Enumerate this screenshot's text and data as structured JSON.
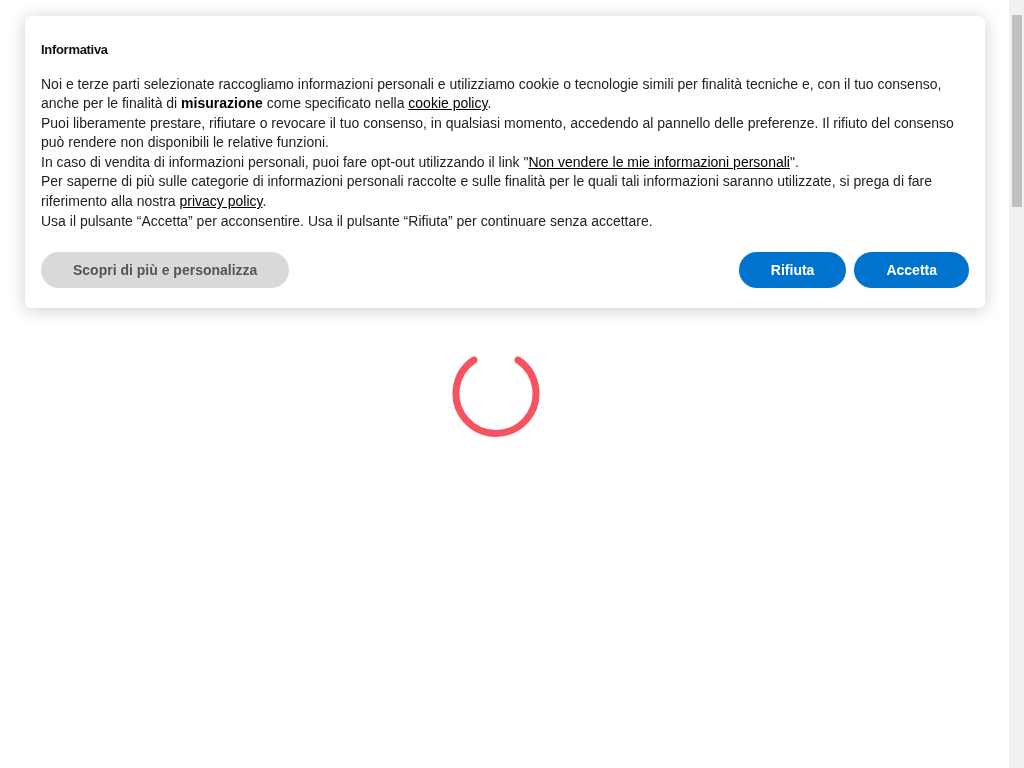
{
  "dialog": {
    "title": "Informativa",
    "paragraphs": [
      [
        {
          "kind": "text",
          "text": "Noi e terze parti selezionate raccogliamo informazioni personali e utilizziamo cookie o tecnologie simili per finalità tecniche e, con il tuo consenso, anche per le finalità di "
        },
        {
          "kind": "bold",
          "text": "misurazione"
        },
        {
          "kind": "text",
          "text": " come specificato nella "
        },
        {
          "kind": "link",
          "text": "cookie policy"
        },
        {
          "kind": "text",
          "text": "."
        }
      ],
      [
        {
          "kind": "text",
          "text": "Puoi liberamente prestare, rifiutare o revocare il tuo consenso, in qualsiasi momento, accedendo al pannello delle preferenze. Il rifiuto del consenso può rendere non disponibili le relative funzioni."
        }
      ],
      [
        {
          "kind": "text",
          "text": "In caso di vendita di informazioni personali, puoi fare opt-out utilizzando il link \""
        },
        {
          "kind": "link",
          "text": "Non vendere le mie informazioni personali"
        },
        {
          "kind": "text",
          "text": "\"."
        }
      ],
      [
        {
          "kind": "text",
          "text": "Per saperne di più sulle categorie di informazioni personali raccolte e sulle finalità per le quali tali informazioni saranno utilizzate, si prega di fare riferimento alla nostra "
        },
        {
          "kind": "link",
          "text": "privacy policy"
        },
        {
          "kind": "text",
          "text": "."
        }
      ],
      [
        {
          "kind": "text",
          "text": "Usa il pulsante “Accetta” per acconsentire. Usa il pulsante “Rifiuta” per continuare senza accettare."
        }
      ]
    ],
    "buttons": [
      {
        "kind": "secondary",
        "label": "Scopri di più e personalizza"
      },
      {
        "kind": "primary",
        "label": "Rifiuta"
      },
      {
        "kind": "primary",
        "label": "Accetta"
      }
    ]
  }
}
